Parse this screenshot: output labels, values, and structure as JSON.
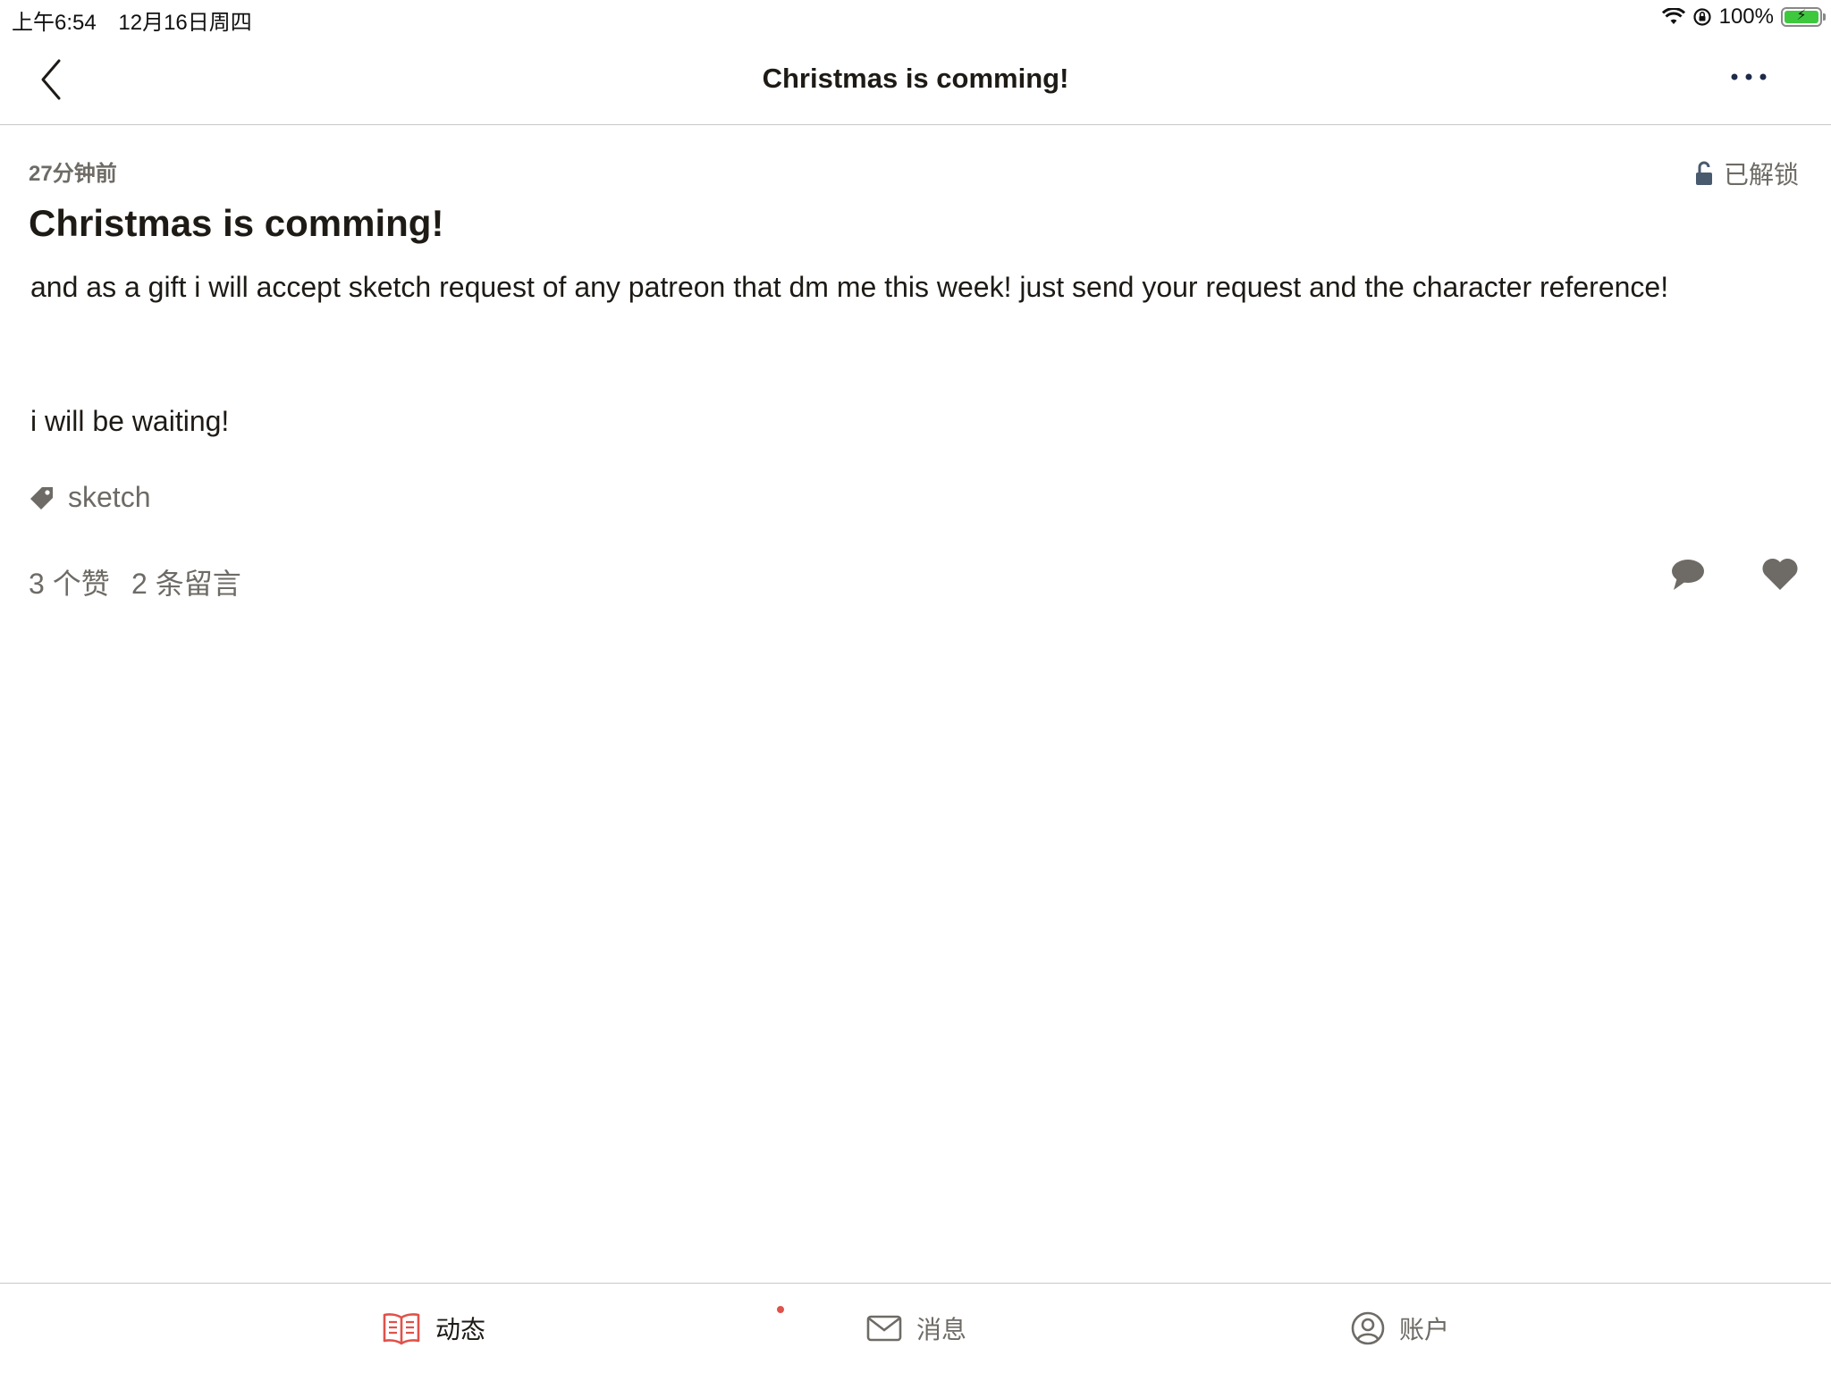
{
  "status_bar": {
    "time": "上午6:54",
    "date": "12月16日周四",
    "battery": "100%",
    "icons": [
      "wifi-icon",
      "rotation-lock-icon",
      "battery-charging-icon"
    ]
  },
  "nav": {
    "title": "Christmas is comming!",
    "icons": [
      "back-chevron-icon",
      "more-dots-icon"
    ]
  },
  "post": {
    "time_ago": "27分钟前",
    "lock_status": "已解锁",
    "title": "Christmas is comming!",
    "body_line1": "and as a gift i will accept sketch request of any patreon that dm me this week! just send your request and the character reference!",
    "body_line2": "i will be waiting!",
    "tag": "sketch",
    "likes": "3 个赞",
    "comments": "2 条留言"
  },
  "tabs": [
    {
      "label": "动态",
      "icon": "book-icon",
      "active": true
    },
    {
      "label": "消息",
      "icon": "mail-icon",
      "active": false,
      "has_notification": true
    },
    {
      "label": "账户",
      "icon": "account-icon",
      "active": false
    }
  ],
  "colors": {
    "text_primary": "#1e1b16",
    "text_secondary": "#6e6b66",
    "accent": "#e0524a",
    "lock_icon": "#4a5a6e"
  }
}
